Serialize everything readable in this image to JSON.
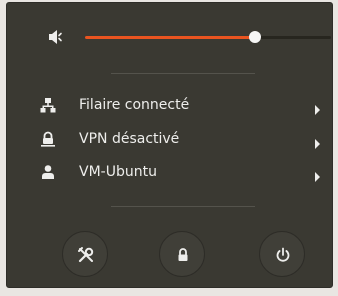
{
  "volume": {
    "icon": "speaker-volume-icon",
    "level": 0.69
  },
  "menu_items": [
    {
      "label": "Filaire connecté",
      "icon": "wired-network-icon"
    },
    {
      "label": "VPN désactivé",
      "icon": "vpn-lock-icon"
    },
    {
      "label": "VM-Ubuntu",
      "icon": "user-icon"
    }
  ],
  "buttons": [
    {
      "icon": "settings-tools-icon"
    },
    {
      "icon": "lock-icon"
    },
    {
      "icon": "power-icon"
    }
  ],
  "colors": {
    "accent": "#e95420",
    "background": "#3a3932",
    "text": "#eeeeec"
  }
}
